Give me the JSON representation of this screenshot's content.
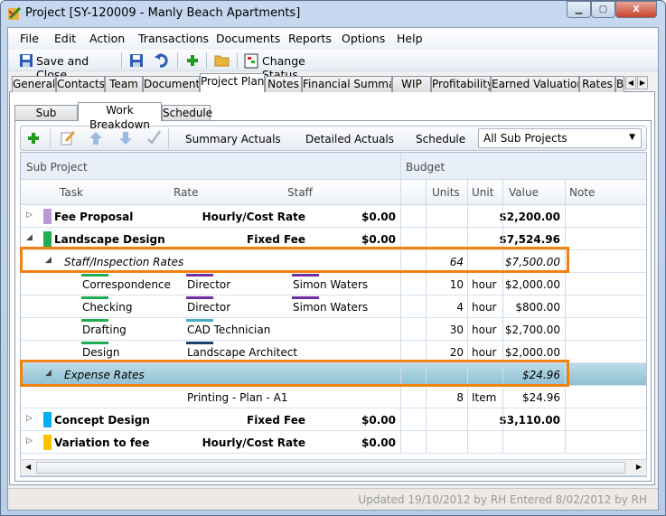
{
  "window": {
    "title": "Project [SY-120009 - Manly Beach Apartments]",
    "minimize": "▁",
    "maximize": "▢",
    "close": "X"
  },
  "menu": [
    "File",
    "Edit",
    "Action",
    "Transactions",
    "Documents",
    "Reports",
    "Options",
    "Help"
  ],
  "toolbar": {
    "save_close": "Save and Close",
    "change_status": "Change Status"
  },
  "tabs": [
    "General",
    "Contacts",
    "Team",
    "Documents",
    "Project Plan",
    "Notes",
    "Financial Summary",
    "WIP",
    "Profitability",
    "Earned Valuations",
    "Rates",
    "B"
  ],
  "active_tab": "Project Plan",
  "subtabs": [
    "Sub Projects",
    "Work Breakdown",
    "Schedule"
  ],
  "grid_toolbar": {
    "summary_actuals": "Summary Actuals",
    "detailed_actuals": "Detailed Actuals",
    "schedule": "Schedule",
    "filter": "All Sub Projects"
  },
  "columns": {
    "group1": "Sub Project",
    "group2": "Budget",
    "task": "Task",
    "rate": "Rate",
    "staff": "Staff",
    "units": "Units",
    "unit": "Unit",
    "value": "Value",
    "note": "Note"
  },
  "rows": [
    {
      "type": "group",
      "expanded": false,
      "color": "#b79bd6",
      "name": "Fee Proposal",
      "rate": "Hourly/Cost Rate",
      "amount": "$0.00",
      "value": "$2,200.00"
    },
    {
      "type": "group",
      "expanded": true,
      "color": "#1fae4f",
      "name": "Landscape Design",
      "rate": "Fixed Fee",
      "amount": "$0.00",
      "value": "$7,524.96"
    },
    {
      "type": "sub",
      "name": "Staff/Inspection Rates",
      "units": "64",
      "value": "$7,500.00",
      "highlighted": true
    },
    {
      "type": "task",
      "task": "Correspondence",
      "task_color": "#1fae4f",
      "rate": "Director",
      "rate_color": "#7030a0",
      "staff": "Simon Waters",
      "staff_color": "#7030a0",
      "units": "10",
      "unit": "hour",
      "value": "$2,000.00"
    },
    {
      "type": "task",
      "task": "Checking",
      "task_color": "#1fae4f",
      "rate": "Director",
      "rate_color": "#7030a0",
      "staff": "Simon Waters",
      "staff_color": "#7030a0",
      "units": "4",
      "unit": "hour",
      "value": "$800.00"
    },
    {
      "type": "task",
      "task": "Drafting",
      "task_color": "#1fae4f",
      "rate": "CAD Technician",
      "rate_color": "#4bacc6",
      "units": "30",
      "unit": "hour",
      "value": "$2,700.00"
    },
    {
      "type": "task",
      "task": "Design",
      "task_color": "#1fae4f",
      "rate": "Landscape Architect",
      "rate_color": "#1f3f6e",
      "units": "20",
      "unit": "hour",
      "value": "$2,000.00"
    },
    {
      "type": "sub",
      "name": "Expense Rates",
      "value": "$24.96",
      "highlighted": true,
      "selected": true
    },
    {
      "type": "task",
      "rate": "Printing - Plan - A1",
      "units": "8",
      "unit": "Item",
      "value": "$24.96"
    },
    {
      "type": "group",
      "expanded": false,
      "color": "#00b0f0",
      "name": "Concept Design",
      "rate": "Fixed Fee",
      "amount": "$0.00",
      "value": "$3,110.00"
    },
    {
      "type": "group",
      "expanded": false,
      "color": "#ffc000",
      "name": "Variation to fee",
      "rate": "Hourly/Cost Rate",
      "amount": "$0.00",
      "value": ""
    }
  ],
  "status": "Updated 19/10/2012 by RH  Entered 8/02/2012 by RH",
  "colors": {
    "highlight": "#f0820f",
    "selected_row": "#a6cfdf"
  }
}
